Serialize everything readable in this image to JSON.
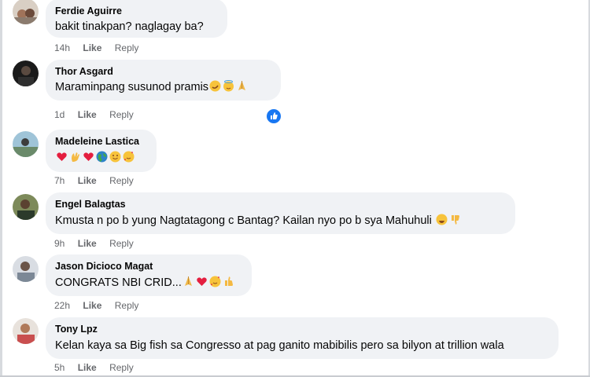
{
  "comments": [
    {
      "author": "Ferdie Aguirre",
      "text": "bakit tinakpan? naglagay ba?",
      "time": "14h",
      "like": "Like",
      "reply": "Reply"
    },
    {
      "author": "Thor Asgard",
      "text": "Maraminpang susunod pramis",
      "time": "1d",
      "like": "Like",
      "reply": "Reply",
      "emojis": [
        "rofl-emoji",
        "innocent-emoji",
        "pray-emoji"
      ],
      "reaction": "like-reaction-icon"
    },
    {
      "author": "Madeleine Lastica",
      "text": "",
      "time": "7h",
      "like": "Like",
      "reply": "Reply",
      "emojis": [
        "heart-emoji",
        "wave-emoji",
        "heart-emoji",
        "globe-emoji",
        "smile-emoji",
        "heart-face-emoji"
      ]
    },
    {
      "author": "Engel Balagtas",
      "text": "Kmusta n po b yung Nagtatagong c Bantag? Kailan nyo po b sya Mahuhuli",
      "time": "9h",
      "like": "Like",
      "reply": "Reply",
      "emojis": [
        "grin-emoji",
        "thumbs-down-emoji"
      ]
    },
    {
      "author": "Jason Dicioco Magat",
      "text": "CONGRATS NBI CRID...",
      "time": "22h",
      "like": "Like",
      "reply": "Reply",
      "emojis": [
        "pray-emoji",
        "heart-emoji",
        "heart-face-emoji",
        "thumbs-up-emoji"
      ]
    },
    {
      "author": "Tony Lpz",
      "text": "Kelan kaya sa Big fish sa Congresso at pag ganito mabibilis pero sa bilyon at trillion wala",
      "time": "5h",
      "like": "Like",
      "reply": "Reply"
    }
  ],
  "colors": {
    "bubble": "#f0f2f5",
    "meta": "#65676b",
    "like_blue": "#1877f2"
  }
}
